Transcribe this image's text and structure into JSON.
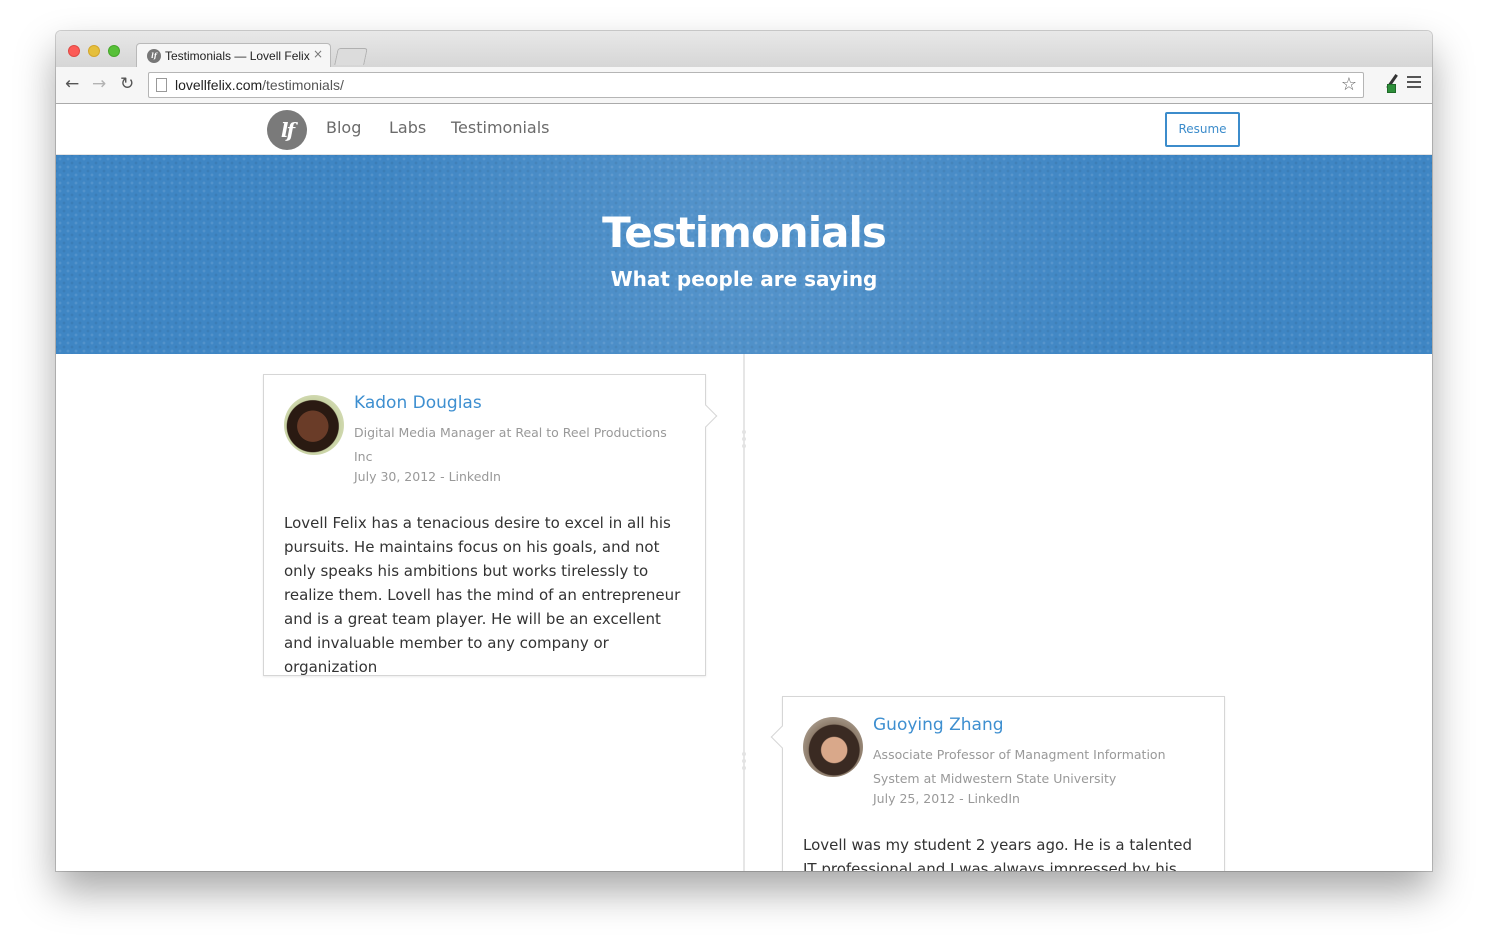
{
  "browser": {
    "tab_title": "Testimonials — Lovell Felix",
    "tab_close": "×",
    "url_host": "lovellfelix.com",
    "url_path": "/testimonials/",
    "favicon_text": "lf"
  },
  "nav": {
    "logo_text": "lf",
    "links": [
      "Blog",
      "Labs",
      "Testimonials"
    ],
    "resume_label": "Resume"
  },
  "hero": {
    "title": "Testimonials",
    "subtitle": "What people are saying"
  },
  "testimonials": [
    {
      "name": "Kadon Douglas",
      "role": "Digital Media Manager at Real to Reel Productions Inc",
      "meta": "July 30, 2012 - LinkedIn",
      "quote": "Lovell Felix has a tenacious desire to excel in all his pursuits. He maintains focus on his goals, and not only speaks his ambitions but works tirelessly to realize them. Lovell has the mind of an entrepreneur and is a great team player. He will be an excellent and invaluable member to any company or organization"
    },
    {
      "name": "Guoying Zhang",
      "role": "Associate Professor of Managment Information System at Midwestern State University",
      "meta": "July 25, 2012 - LinkedIn",
      "quote": "Lovell was my student 2 years ago. He is a talented IT professional and I was always impressed by his"
    }
  ],
  "icons": {
    "back": "back-arrow-icon",
    "forward": "forward-arrow-icon",
    "reload": "reload-icon",
    "star": "bookmark-star-icon",
    "menu": "hamburger-menu-icon"
  },
  "colors": {
    "accent": "#3c8ccb",
    "hero_bg": "#3f86c4",
    "name_link": "#3e8fd0"
  }
}
